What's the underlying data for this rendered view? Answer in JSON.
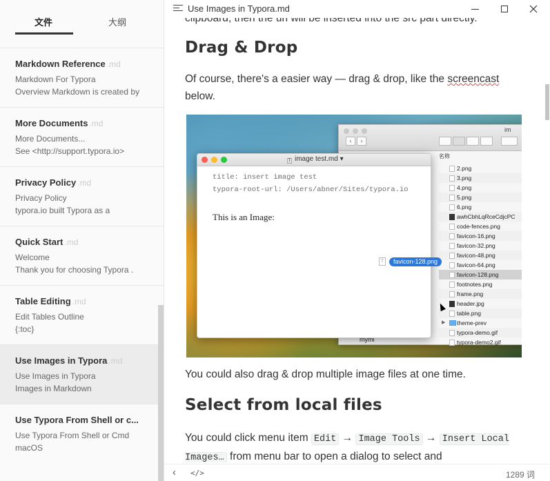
{
  "sidebar": {
    "tab_files": "文件",
    "tab_outline": "大纲",
    "items": [
      {
        "title": "Markdown Reference",
        "ext": ".md",
        "line1": "Markdown For Typora",
        "line2": "Overview Markdown is created by"
      },
      {
        "title": "More Documents",
        "ext": ".md",
        "line1": "More Documents...",
        "line2": "See <http://support.typora.io>"
      },
      {
        "title": "Privacy Policy",
        "ext": ".md",
        "line1": "Privacy Policy",
        "line2": "typora.io built Typora as a"
      },
      {
        "title": "Quick Start",
        "ext": ".md",
        "line1": "Welcome",
        "line2": "Thank you for choosing Typora ."
      },
      {
        "title": "Table Editing",
        "ext": ".md",
        "line1": "Edit Tables Outline",
        "line2": "{:toc}"
      },
      {
        "title": "Use Images in Typora",
        "ext": ".md",
        "line1": "Use Images in Typora",
        "line2": "Images in Markdown"
      },
      {
        "title": "Use Typora From Shell or c...",
        "ext": "",
        "line1": "Use Typora From Shell or Cmd",
        "line2": "macOS"
      }
    ]
  },
  "titlebar": {
    "title": "Use Images in Typora.md",
    "close_glyph": "✕"
  },
  "content": {
    "cutoff_line": "clipboard, then the url will be inserted into the src part directly.",
    "heading1": "Drag & Drop",
    "para1_before": "Of course, there's a easier way — drag & drop, like the ",
    "para1_link": "screencast",
    "para1_after": " below.",
    "para2": "You could also drag & drop multiple image files at one time.",
    "heading2": "Select from local files",
    "para3_a": "You could click menu item ",
    "code_edit": "Edit",
    "arrow": " → ",
    "code_image_tools": "Image Tools",
    "code_insert": "Insert Local Images…",
    "para3_b": " from menu bar to open a dialog to select and"
  },
  "screencast": {
    "finder_folder": "im",
    "finder_header": "名称",
    "files": [
      {
        "name": "2.png",
        "icon": "file"
      },
      {
        "name": "3.png",
        "icon": "file"
      },
      {
        "name": "4.png",
        "icon": "file"
      },
      {
        "name": "5.png",
        "icon": "file"
      },
      {
        "name": "6.png",
        "icon": "file"
      },
      {
        "name": "awhCbhLqRceCdjcPC",
        "icon": "dark"
      },
      {
        "name": "code-fences.png",
        "icon": "file"
      },
      {
        "name": "favicon-16.png",
        "icon": "file"
      },
      {
        "name": "favicon-32.png",
        "icon": "file"
      },
      {
        "name": "favicon-48.png",
        "icon": "file"
      },
      {
        "name": "favicon-64.png",
        "icon": "file"
      },
      {
        "name": "favicon-128.png",
        "icon": "file",
        "selected": true
      },
      {
        "name": "footnotes.png",
        "icon": "file"
      },
      {
        "name": "frame.png",
        "icon": "file"
      },
      {
        "name": "header.jpg",
        "icon": "dark"
      },
      {
        "name": "table.png",
        "icon": "file"
      },
      {
        "name": "theme-prev",
        "icon": "folder",
        "expandable": true
      },
      {
        "name": "typora-demo.gif",
        "icon": "file"
      },
      {
        "name": "typora-demo2.gif",
        "icon": "file"
      }
    ],
    "finder_sidebar_item": "mymi",
    "typora_window_title": "image test.md",
    "front_matter_1": "title: insert image test",
    "front_matter_2": "typora-root-url: /Users/abner/Sites/typora.io",
    "body_text": "This is an Image:",
    "drag_label": "favicon-128.png"
  },
  "footer": {
    "back_glyph": "‹",
    "source_glyph": "</>",
    "word_count": "1289 词"
  },
  "colors": {
    "accent_link_underline": "#e04848",
    "selection_chip": "#2c77d8",
    "sidebar_active": "#ececec"
  }
}
